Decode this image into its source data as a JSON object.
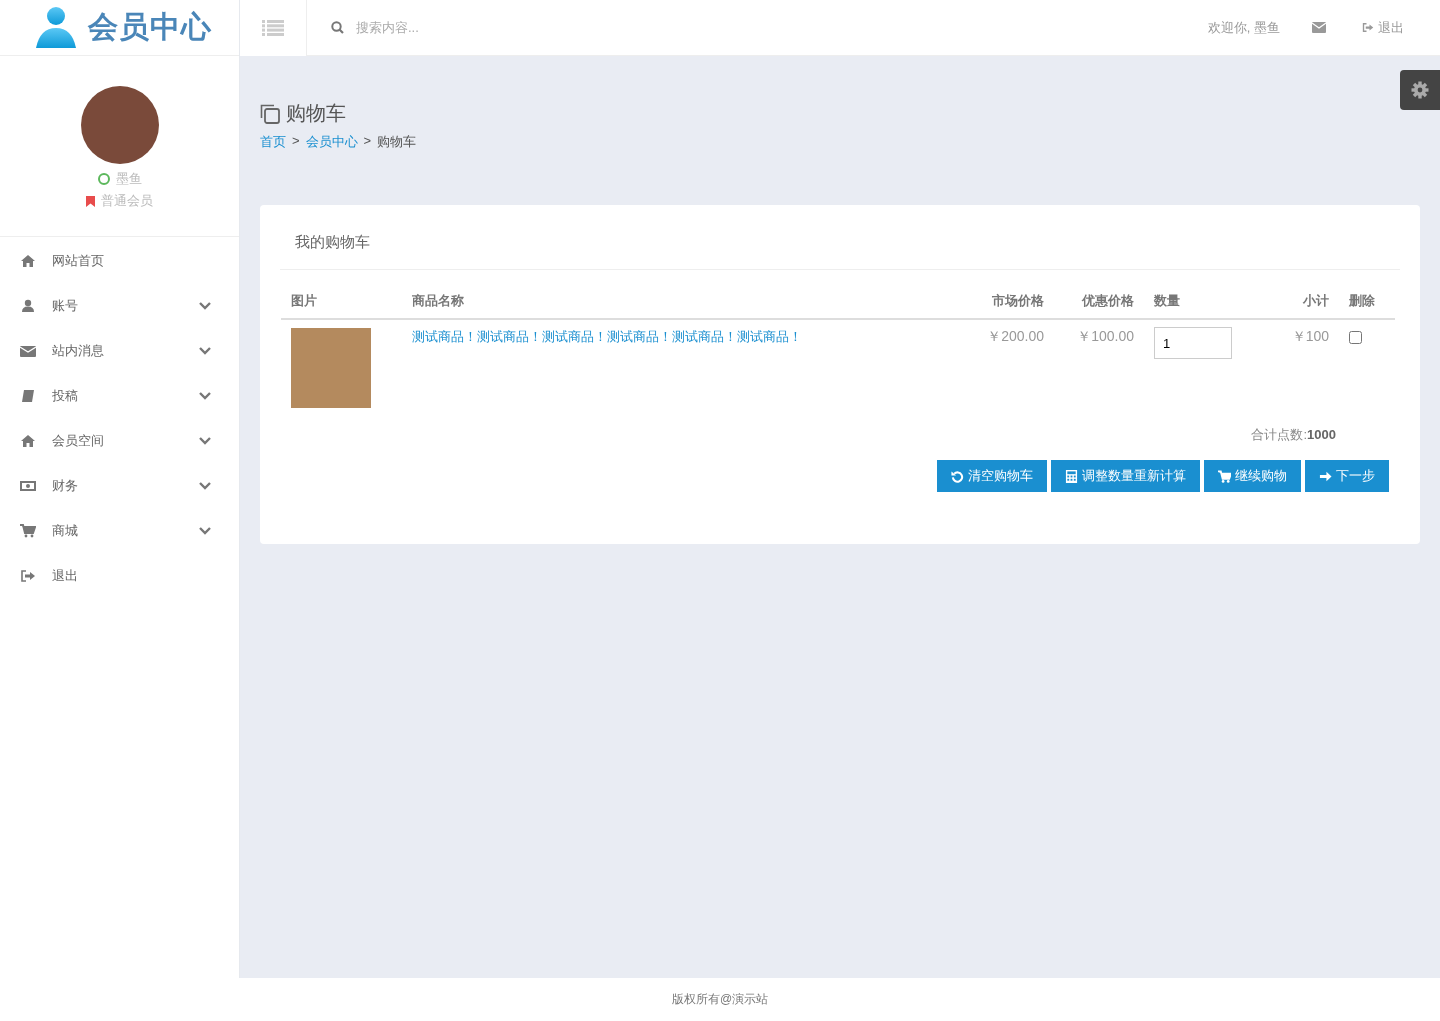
{
  "header": {
    "logo_text": "会员中心",
    "search": {
      "placeholder": "搜索内容..."
    },
    "welcome": "欢迎你, 墨鱼",
    "logout": "退出"
  },
  "profile": {
    "name": "墨鱼",
    "online": true,
    "level": "普通会员"
  },
  "sidebar": {
    "items": [
      {
        "label": "网站首页",
        "has_submenu": false
      },
      {
        "label": "账号",
        "has_submenu": true
      },
      {
        "label": "站内消息",
        "has_submenu": true
      },
      {
        "label": "投稿",
        "has_submenu": true
      },
      {
        "label": "会员空间",
        "has_submenu": true
      },
      {
        "label": "财务",
        "has_submenu": true
      },
      {
        "label": "商城",
        "has_submenu": true
      },
      {
        "label": "退出",
        "has_submenu": false
      }
    ]
  },
  "page": {
    "title": "购物车",
    "breadcrumb": [
      "首页",
      "会员中心",
      "购物车"
    ],
    "breadcrumb_separator": ">"
  },
  "cart": {
    "title": "我的购物车",
    "columns": [
      "图片",
      "商品名称",
      "市场价格",
      "优惠价格",
      "数量",
      "小计",
      "删除"
    ],
    "rows": [
      {
        "name": "测试商品！测试商品！测试商品！测试商品！测试商品！测试商品！",
        "market_price": "￥200.00",
        "sale_price": "￥100.00",
        "quantity": "1",
        "subtotal": "￥100",
        "checked": false
      }
    ],
    "total_label": "合计点数:",
    "total_value": "1000",
    "buttons": [
      "清空购物车",
      "调整数量重新计算",
      "继续购物",
      "下一步"
    ]
  },
  "footer": "版权所有@演示站"
}
